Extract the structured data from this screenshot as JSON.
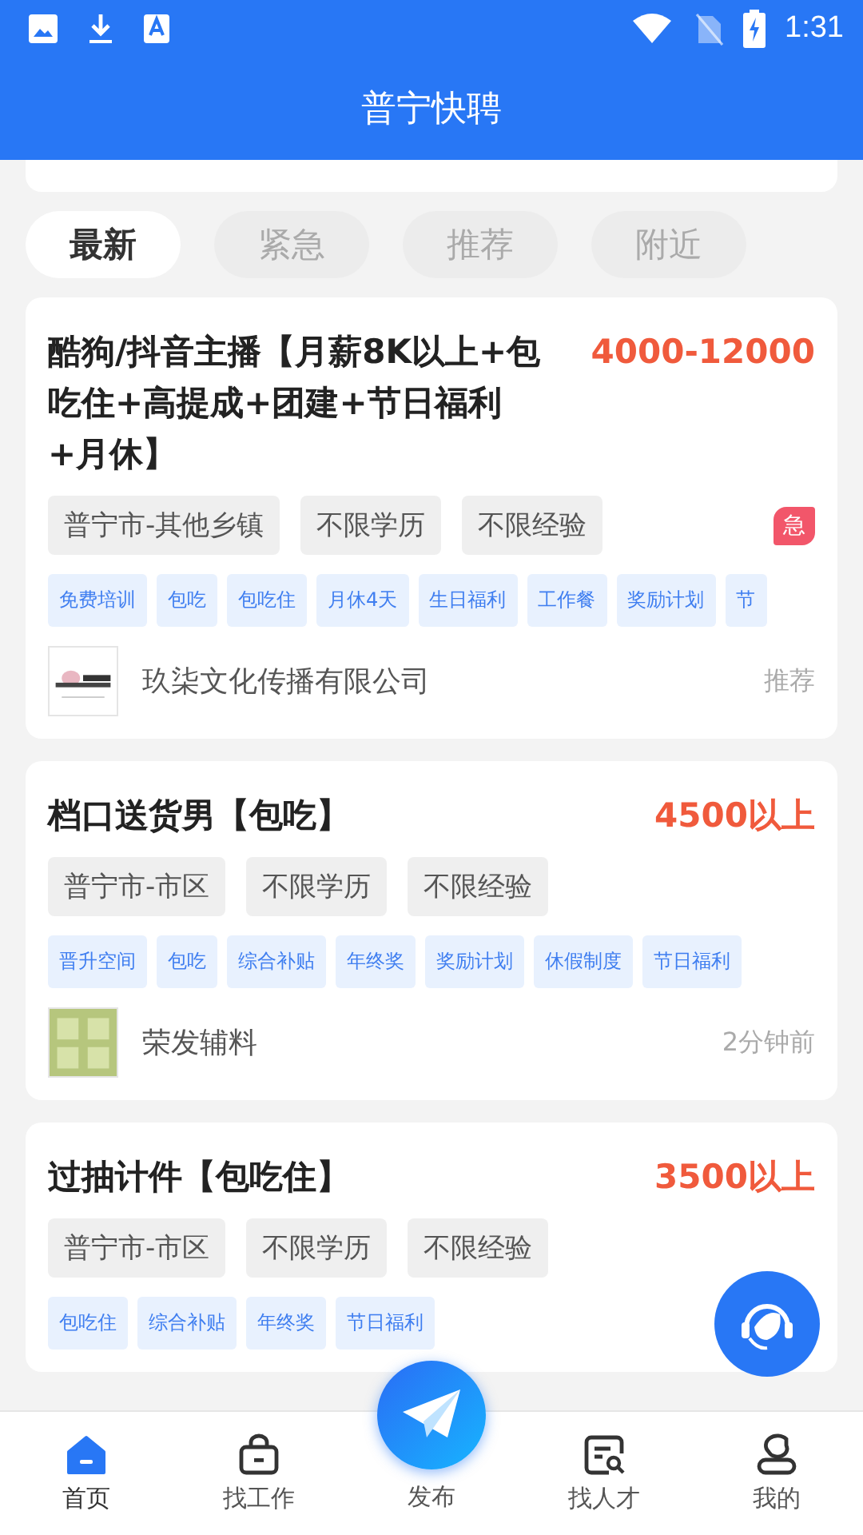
{
  "status_bar": {
    "time": "1:31"
  },
  "header": {
    "title": "普宁快聘"
  },
  "tabs": [
    {
      "label": "最新",
      "selected": true
    },
    {
      "label": "紧急",
      "selected": false
    },
    {
      "label": "推荐",
      "selected": false
    },
    {
      "label": "附近",
      "selected": false
    }
  ],
  "jobs": [
    {
      "title": "酷狗/抖音主播【月薪8K以上+包吃住+高提成+团建+节日福利+月休】",
      "salary": "4000-12000",
      "urgent": true,
      "urgent_label": "急",
      "requirements": [
        "普宁市-其他乡镇",
        "不限学历",
        "不限经验"
      ],
      "benefits": [
        "免费培训",
        "包吃",
        "包吃住",
        "月休4天",
        "生日福利",
        "工作餐",
        "奖励计划",
        "节"
      ],
      "company": "玖柒文化传播有限公司",
      "logo": {
        "kind": "picture"
      },
      "meta": "推荐"
    },
    {
      "title": "档口送货男【包吃】",
      "salary": "4500以上",
      "urgent": false,
      "requirements": [
        "普宁市-市区",
        "不限学历",
        "不限经验"
      ],
      "benefits": [
        "晋升空间",
        "包吃",
        "综合补贴",
        "年终奖",
        "奖励计划",
        "休假制度",
        "节日福利"
      ],
      "company": "荣发辅料",
      "logo": {
        "kind": "picture"
      },
      "meta": "2分钟前"
    },
    {
      "title": "过抽计件【包吃住】",
      "salary": "3500以上",
      "urgent": false,
      "requirements": [
        "普宁市-市区",
        "不限学历",
        "不限经验"
      ],
      "benefits": [
        "包吃住",
        "综合补贴",
        "年终奖",
        "节日福利"
      ]
    }
  ],
  "nav": [
    {
      "label": "首页",
      "selected": true,
      "kind": "home"
    },
    {
      "label": "找工作",
      "selected": false,
      "kind": "jobs"
    },
    {
      "label": "发布",
      "selected": false,
      "kind": "publish"
    },
    {
      "label": "找人才",
      "selected": false,
      "kind": "talent"
    },
    {
      "label": "我的",
      "selected": false,
      "kind": "me"
    }
  ]
}
